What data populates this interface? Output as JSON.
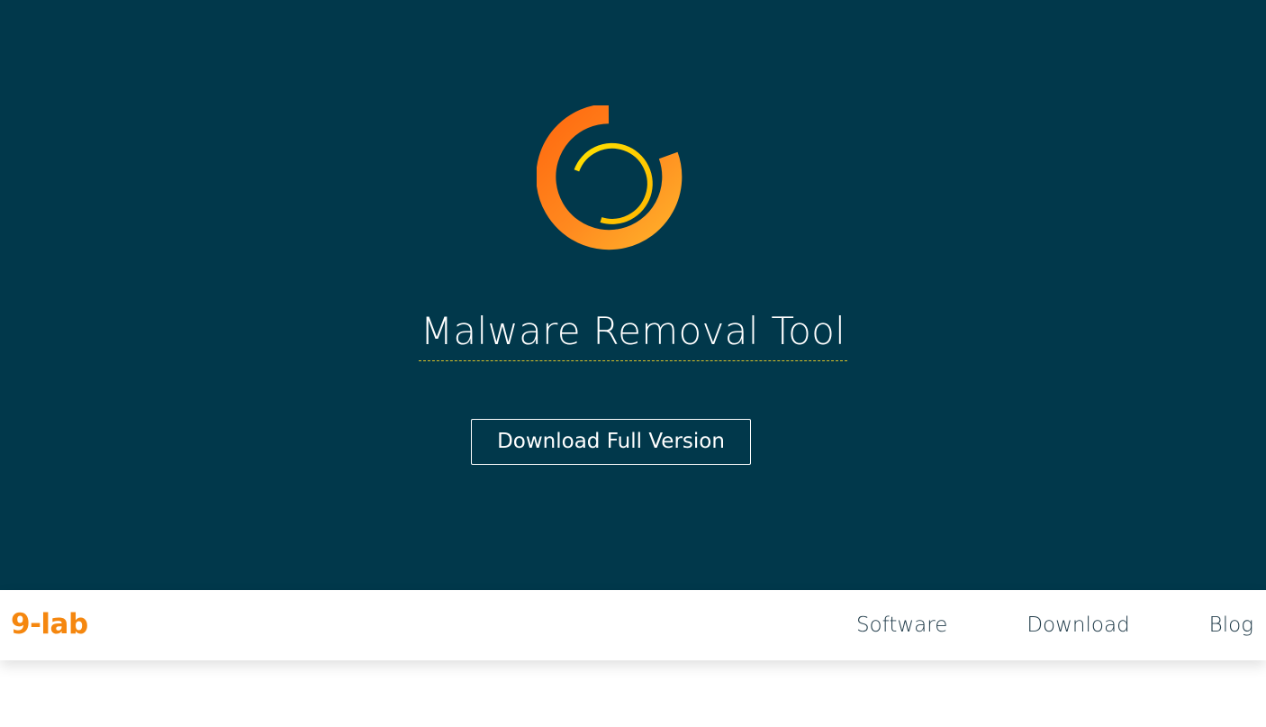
{
  "hero": {
    "logo_icon": "orange-ring-logo-icon",
    "title": "Malware Removal Tool",
    "cta_label": "Download Full Version"
  },
  "navbar": {
    "brand": "9-lab",
    "links": [
      {
        "label": "Software"
      },
      {
        "label": "Download"
      },
      {
        "label": "Blog"
      }
    ]
  },
  "colors": {
    "hero_bg": "#01384b",
    "brand": "#f5870f",
    "logo_orange": "#ff7a1a",
    "logo_yellow": "#ffd400",
    "title_underline": "#d9c228",
    "nav_text": "#1f3a48"
  }
}
